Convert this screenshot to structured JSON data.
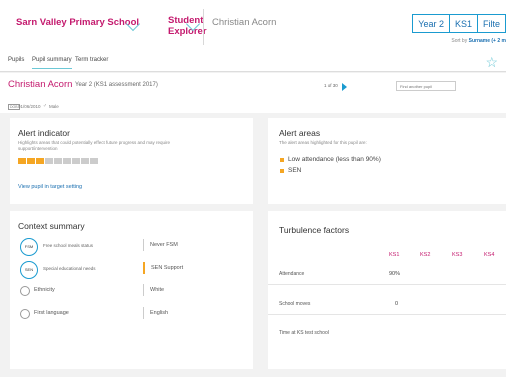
{
  "header": {
    "school": "Sarn Valley Primary School",
    "tool": "Student Explorer",
    "pupil": "Christian Acorn",
    "filters": [
      "Year 2",
      "KS1",
      "Filte"
    ],
    "sort_prefix": "Sort by",
    "sort_value": "Surname (+ 2 m"
  },
  "tabs": [
    "Pupils",
    "Pupil summary",
    "Term tracker"
  ],
  "pupil": {
    "name": "Christian Acorn",
    "meta": "Year 2 (KS1 assessment 2017)",
    "pager": "1 of 30",
    "find_placeholder": "Find another pupil",
    "dob_tag": "DOB",
    "dob": "01/06/2010",
    "gender": "Male"
  },
  "alert_indicator": {
    "title": "Alert indicator",
    "subtitle": "Highlights areas that could potentially effect future progress and may require support/intervention",
    "level_filled": 3,
    "level_total": 9,
    "link": "View pupil in target setting"
  },
  "alert_areas": {
    "title": "Alert areas",
    "subtitle": "The alert areas highlighted for this pupil are:",
    "items": [
      "Low attendance (less than 90%)",
      "SEN"
    ]
  },
  "context": {
    "title": "Context summary",
    "rows": [
      {
        "badge": "FSM",
        "label": "Free school meals status",
        "value": "Never FSM"
      },
      {
        "badge": "SEN",
        "label": "Special educational needs",
        "value": "SEN Support"
      },
      {
        "badge": "",
        "label": "Ethnicity",
        "value": "White"
      },
      {
        "badge": "",
        "label": "First language",
        "value": "English"
      }
    ]
  },
  "turbulence": {
    "title": "Turbulence factors",
    "columns": [
      "KS1",
      "KS2",
      "KS3",
      "KS4"
    ],
    "rows": [
      {
        "label": "Attendance",
        "value": "90%"
      },
      {
        "label": "School moves",
        "value": "0"
      },
      {
        "label": "Time at KS test school",
        "value": ""
      }
    ]
  },
  "colors": {
    "brand": "#c41a6e",
    "accent": "#1a9bd0",
    "alert": "#f5a623"
  }
}
